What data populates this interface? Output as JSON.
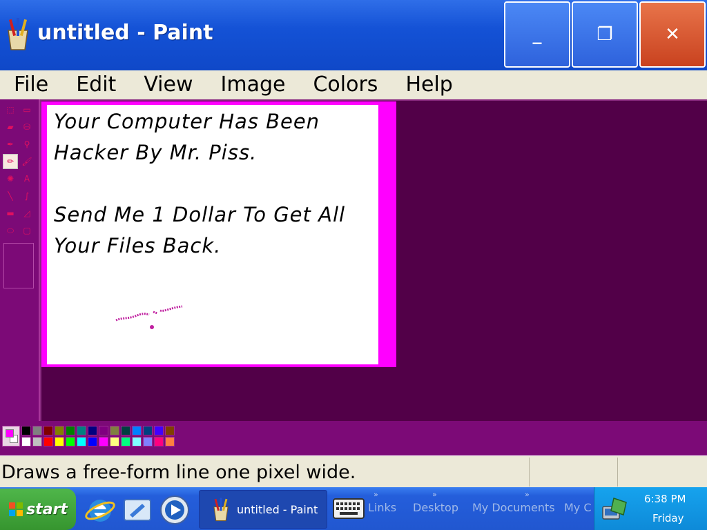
{
  "window": {
    "title": "untitled - Paint",
    "min_glyph": "_",
    "max_glyph": "❐",
    "close_glyph": "✕"
  },
  "menu": [
    "File",
    "Edit",
    "View",
    "Image",
    "Colors",
    "Help"
  ],
  "tools": [
    {
      "name": "free-form-select",
      "glyph": "⬚"
    },
    {
      "name": "select",
      "glyph": "▭"
    },
    {
      "name": "eraser",
      "glyph": "▰"
    },
    {
      "name": "fill",
      "glyph": "⛁"
    },
    {
      "name": "pick-color",
      "glyph": "✒"
    },
    {
      "name": "magnifier",
      "glyph": "⚲"
    },
    {
      "name": "pencil",
      "glyph": "✏",
      "selected": true
    },
    {
      "name": "brush",
      "glyph": "🖌"
    },
    {
      "name": "airbrush",
      "glyph": "✺"
    },
    {
      "name": "text",
      "glyph": "A"
    },
    {
      "name": "line",
      "glyph": "╲"
    },
    {
      "name": "curve",
      "glyph": "∫"
    },
    {
      "name": "rectangle",
      "glyph": "▬"
    },
    {
      "name": "polygon",
      "glyph": "◿"
    },
    {
      "name": "ellipse",
      "glyph": "⬭"
    },
    {
      "name": "rounded-rectangle",
      "glyph": "▢"
    }
  ],
  "canvas": {
    "line1": "Your Computer Has Been",
    "line2": "Hacker By Mr. Piss.",
    "line3": "Send Me 1 Dollar To Get All",
    "line4": "Your Files Back."
  },
  "palette": {
    "top": [
      "#000000",
      "#808080",
      "#800000",
      "#808000",
      "#008000",
      "#008080",
      "#000080",
      "#800080",
      "#808040",
      "#004040",
      "#0080ff",
      "#004080",
      "#4000ff",
      "#804000"
    ],
    "bottom": [
      "#ffffff",
      "#c0c0c0",
      "#ff0000",
      "#ffff00",
      "#00ff00",
      "#00ffff",
      "#0000ff",
      "#ff00ff",
      "#ffff80",
      "#00ff80",
      "#80ffff",
      "#8080ff",
      "#ff0080",
      "#ff8040"
    ],
    "primary": "#000000",
    "secondary": "#ffffff"
  },
  "status": {
    "text": "Draws a free-form line one pixel wide."
  },
  "taskbar": {
    "start_label": "start",
    "task_label": "untitled - Paint",
    "links": [
      "Links",
      "Desktop",
      "My Documents",
      "My C"
    ],
    "time": "6:38 PM",
    "day": "Friday"
  }
}
